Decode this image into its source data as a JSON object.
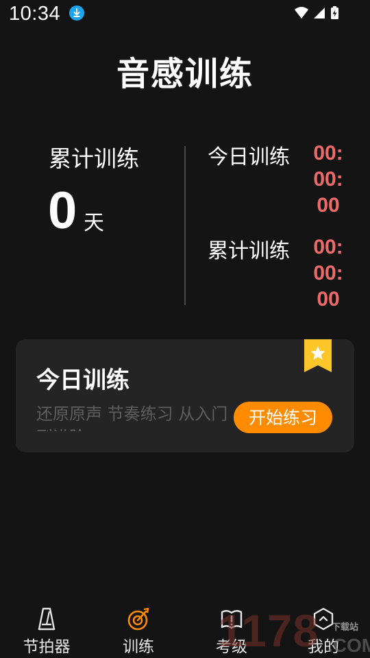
{
  "status_bar": {
    "time": "10:34",
    "icons": [
      "download-icon",
      "wifi-icon",
      "cellular-signal-icon",
      "battery-charging-icon"
    ]
  },
  "header": {
    "title": "音感训练"
  },
  "stats": {
    "total_days_label": "累计训练",
    "total_days_value": "0",
    "total_days_unit": "天",
    "today_label": "今日训练",
    "today_time": "00:00:00",
    "total_label": "累计训练",
    "total_time": "00:00:00"
  },
  "colors": {
    "background": "#141414",
    "card": "#242424",
    "accent": "#ff8c00",
    "time_red": "#f06a6a",
    "badge_yellow": "#ffc62a",
    "nav_active": "#ff8c00"
  },
  "training_card": {
    "title": "今日训练",
    "description": "还原原声  节奏练习  从入门到进阶",
    "start_label": "开始练习",
    "badge_icon": "star-bookmark-icon"
  },
  "bottom_nav": {
    "items": [
      {
        "label": "节拍器",
        "icon": "metronome-icon",
        "active": false
      },
      {
        "label": "训练",
        "icon": "target-dart-icon",
        "active": true
      },
      {
        "label": "考级",
        "icon": "book-icon",
        "active": false
      },
      {
        "label": "我的",
        "icon": "hexagon-profile-icon",
        "active": false
      }
    ]
  },
  "watermark": {
    "digits": "1178",
    "site": "下载站",
    "domain": ".COM"
  }
}
